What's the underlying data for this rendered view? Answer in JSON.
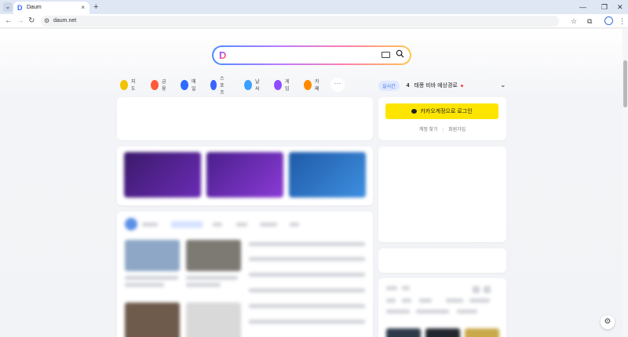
{
  "browser": {
    "tab_title": "Daum",
    "url": "daum.net",
    "new_tab": "+",
    "tab_close": "×"
  },
  "search": {
    "logo": "D"
  },
  "quick_links": [
    {
      "label": "지도",
      "color": "#f2c200"
    },
    {
      "label": "금융",
      "color": "#ff5a3a"
    },
    {
      "label": "메일",
      "color": "#2f6bff"
    },
    {
      "label": "스포츠",
      "color": "#3a63ff"
    },
    {
      "label": "날씨",
      "color": "#3aa0ff"
    },
    {
      "label": "게임",
      "color": "#8e4cff"
    },
    {
      "label": "카페",
      "color": "#ff8a00"
    }
  ],
  "more_label": "···",
  "realtime": {
    "badge": "실시간",
    "rank": "4",
    "text": "태풍 비바 예상경로"
  },
  "login": {
    "button": "카카오계정으로 로그인",
    "find_account": "계정 찾기",
    "sep": "|",
    "signup": "회원가입"
  }
}
